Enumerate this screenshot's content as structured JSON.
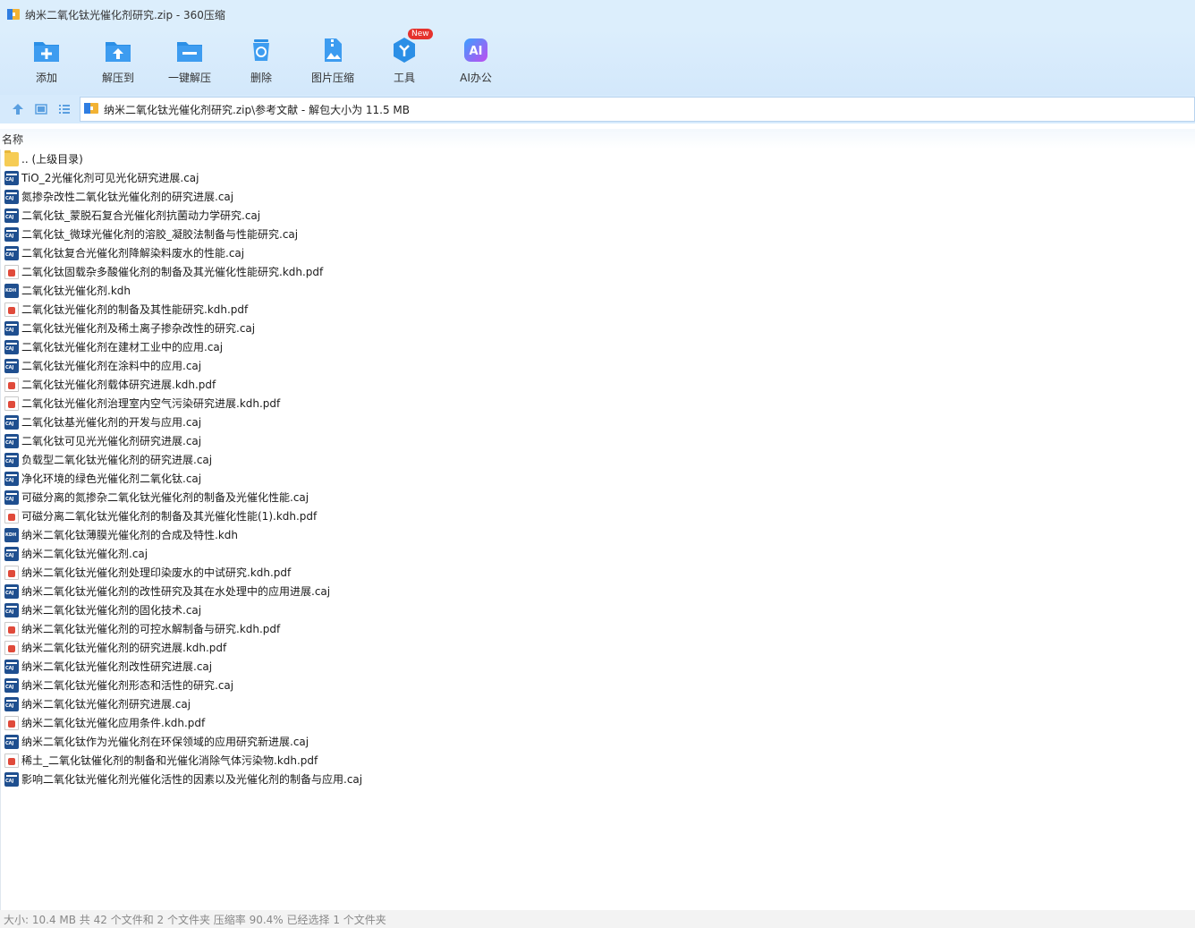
{
  "window": {
    "title": "纳米二氧化钛光催化剂研究.zip - 360压缩"
  },
  "toolbar": {
    "items": [
      {
        "label": "添加",
        "icon": "add-icon"
      },
      {
        "label": "解压到",
        "icon": "extract-to-icon"
      },
      {
        "label": "一键解压",
        "icon": "one-click-extract-icon"
      },
      {
        "label": "删除",
        "icon": "delete-icon"
      },
      {
        "label": "图片压缩",
        "icon": "image-compress-icon"
      },
      {
        "label": "工具",
        "icon": "tools-icon",
        "badge": "New"
      },
      {
        "label": "AI办公",
        "icon": "ai-office-icon"
      }
    ]
  },
  "address": {
    "path": "纳米二氧化钛光催化剂研究.zip\\参考文献 - 解包大小为 11.5 MB"
  },
  "columns": {
    "name": "名称"
  },
  "files": [
    {
      "name": ".. (上级目录)",
      "type": "folder"
    },
    {
      "name": "TiO_2光催化剂可见光化研究进展.caj",
      "type": "caj"
    },
    {
      "name": "氮掺杂改性二氧化钛光催化剂的研究进展.caj",
      "type": "caj"
    },
    {
      "name": "二氧化钛_蒙脱石复合光催化剂抗菌动力学研究.caj",
      "type": "caj"
    },
    {
      "name": "二氧化钛_微球光催化剂的溶胶_凝胶法制备与性能研究.caj",
      "type": "caj"
    },
    {
      "name": "二氧化钛复合光催化剂降解染料废水的性能.caj",
      "type": "caj"
    },
    {
      "name": "二氧化钛固载杂多酸催化剂的制备及其光催化性能研究.kdh.pdf",
      "type": "pdf"
    },
    {
      "name": "二氧化钛光催化剂.kdh",
      "type": "kdh"
    },
    {
      "name": "二氧化钛光催化剂的制备及其性能研究.kdh.pdf",
      "type": "pdf"
    },
    {
      "name": "二氧化钛光催化剂及稀土离子掺杂改性的研究.caj",
      "type": "caj"
    },
    {
      "name": "二氧化钛光催化剂在建材工业中的应用.caj",
      "type": "caj"
    },
    {
      "name": "二氧化钛光催化剂在涂料中的应用.caj",
      "type": "caj"
    },
    {
      "name": "二氧化钛光催化剂载体研究进展.kdh.pdf",
      "type": "pdf"
    },
    {
      "name": "二氧化钛光催化剂治理室内空气污染研究进展.kdh.pdf",
      "type": "pdf"
    },
    {
      "name": "二氧化钛基光催化剂的开发与应用.caj",
      "type": "caj"
    },
    {
      "name": "二氧化钛可见光光催化剂研究进展.caj",
      "type": "caj"
    },
    {
      "name": "负载型二氧化钛光催化剂的研究进展.caj",
      "type": "caj"
    },
    {
      "name": "净化环境的绿色光催化剂二氧化钛.caj",
      "type": "caj"
    },
    {
      "name": "可磁分离的氮掺杂二氧化钛光催化剂的制备及光催化性能.caj",
      "type": "caj"
    },
    {
      "name": "可磁分离二氧化钛光催化剂的制备及其光催化性能(1).kdh.pdf",
      "type": "pdf"
    },
    {
      "name": "纳米二氧化钛薄膜光催化剂的合成及特性.kdh",
      "type": "kdh"
    },
    {
      "name": "纳米二氧化钛光催化剂.caj",
      "type": "caj"
    },
    {
      "name": "纳米二氧化钛光催化剂处理印染废水的中试研究.kdh.pdf",
      "type": "pdf"
    },
    {
      "name": "纳米二氧化钛光催化剂的改性研究及其在水处理中的应用进展.caj",
      "type": "caj"
    },
    {
      "name": "纳米二氧化钛光催化剂的固化技术.caj",
      "type": "caj"
    },
    {
      "name": "纳米二氧化钛光催化剂的可控水解制备与研究.kdh.pdf",
      "type": "pdf"
    },
    {
      "name": "纳米二氧化钛光催化剂的研究进展.kdh.pdf",
      "type": "pdf"
    },
    {
      "name": "纳米二氧化钛光催化剂改性研究进展.caj",
      "type": "caj"
    },
    {
      "name": "纳米二氧化钛光催化剂形态和活性的研究.caj",
      "type": "caj"
    },
    {
      "name": "纳米二氧化钛光催化剂研究进展.caj",
      "type": "caj"
    },
    {
      "name": "纳米二氧化钛光催化应用条件.kdh.pdf",
      "type": "pdf"
    },
    {
      "name": "纳米二氧化钛作为光催化剂在环保领域的应用研究新进展.caj",
      "type": "caj"
    },
    {
      "name": "稀土_二氧化钛催化剂的制备和光催化消除气体污染物.kdh.pdf",
      "type": "pdf"
    },
    {
      "name": "影响二氧化钛光催化剂光催化活性的因素以及光催化剂的制备与应用.caj",
      "type": "caj"
    }
  ],
  "status": {
    "text": "大小: 10.4 MB 共 42 个文件和 2 个文件夹 压缩率 90.4% 已经选择 1 个文件夹"
  },
  "colors": {
    "chrome_bg": "#dceefc",
    "accent_blue": "#2b8fe6",
    "delete_red": "#e5322d"
  }
}
